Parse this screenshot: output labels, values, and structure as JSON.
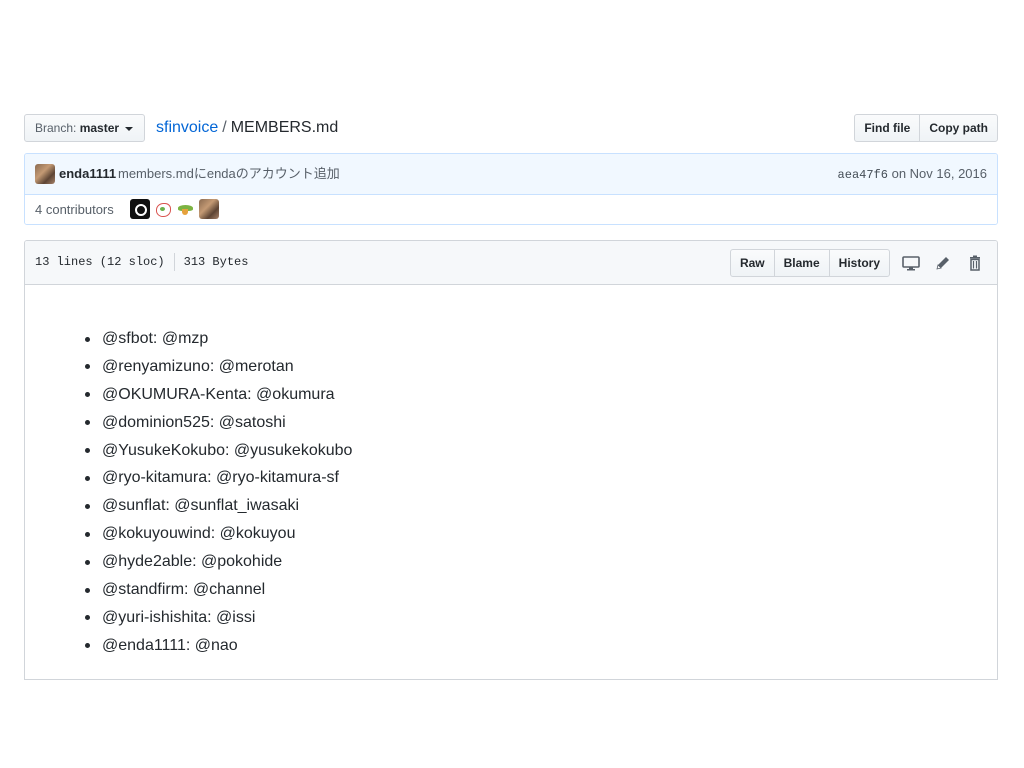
{
  "file_nav": {
    "branch_label": "Branch:",
    "branch_value": "master",
    "repo_link": "sfinvoice",
    "separator": "/",
    "file_name": "MEMBERS.md",
    "find_file": "Find file",
    "copy_path": "Copy path"
  },
  "commit": {
    "author": "enda1111",
    "message": "members.mdにendaのアカウント追加",
    "sha": "aea47f6",
    "date": "on Nov 16, 2016"
  },
  "contributors": {
    "label": "4 contributors",
    "avatars": [
      "camera-avatar",
      "sketch-avatar",
      "bird-avatar",
      "enda-avatar"
    ]
  },
  "file_header": {
    "lines": "13 lines (12 sloc)",
    "size": "313 Bytes",
    "raw": "Raw",
    "blame": "Blame",
    "history": "History",
    "icons": [
      "desktop-icon",
      "pencil-icon",
      "trash-icon"
    ]
  },
  "members": [
    "@sfbot: @mzp",
    "@renyamizuno: @merotan",
    "@OKUMURA-Kenta: @okumura",
    "@dominion525: @satoshi",
    "@YusukeKokubo: @yusukekokubo",
    "@ryo-kitamura: @ryo-kitamura-sf",
    "@sunflat: @sunflat_iwasaki",
    "@kokuyouwind: @kokuyou",
    "@hyde2able: @pokohide",
    "@standfirm: @channel",
    "@yuri-ishishita: @issi",
    "@enda1111: @nao"
  ],
  "colors": {
    "link": "#0366d6",
    "commit_bg": "#f1f8ff",
    "commit_border": "#c8e1ff",
    "border": "#d1d5da"
  }
}
